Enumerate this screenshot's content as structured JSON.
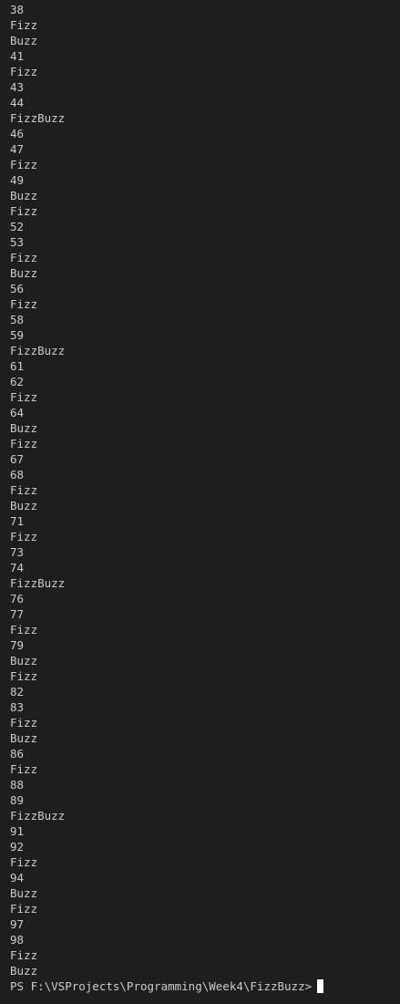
{
  "terminal": {
    "lines": [
      "38",
      "Fizz",
      "Buzz",
      "41",
      "Fizz",
      "43",
      "44",
      "FizzBuzz",
      "46",
      "47",
      "Fizz",
      "49",
      "Buzz",
      "Fizz",
      "52",
      "53",
      "Fizz",
      "Buzz",
      "56",
      "Fizz",
      "58",
      "59",
      "FizzBuzz",
      "61",
      "62",
      "Fizz",
      "64",
      "Buzz",
      "Fizz",
      "67",
      "68",
      "Fizz",
      "Buzz",
      "71",
      "Fizz",
      "73",
      "74",
      "FizzBuzz",
      "76",
      "77",
      "Fizz",
      "79",
      "Buzz",
      "Fizz",
      "82",
      "83",
      "Fizz",
      "Buzz",
      "86",
      "Fizz",
      "88",
      "89",
      "FizzBuzz",
      "91",
      "92",
      "Fizz",
      "94",
      "Buzz",
      "Fizz",
      "97",
      "98",
      "Fizz",
      "Buzz"
    ],
    "prompt": "PS F:\\VSProjects\\Programming\\Week4\\FizzBuzz>"
  },
  "colors": {
    "background": "#1e1e1e",
    "text": "#cccccc",
    "cursor": "#ffffff"
  }
}
